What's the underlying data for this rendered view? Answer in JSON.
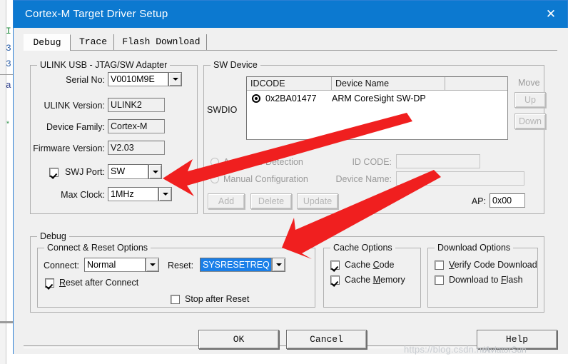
{
  "window": {
    "title": "Cortex-M Target Driver Setup",
    "close_icon": "close-icon"
  },
  "tabs": [
    {
      "label": "Debug",
      "active": true
    },
    {
      "label": "Trace",
      "active": false
    },
    {
      "label": "Flash Download",
      "active": false
    }
  ],
  "ulink_group": {
    "title": "ULINK USB - JTAG/SW Adapter",
    "serial_label": "Serial No:",
    "serial_value": "V0010M9E",
    "ulink_version_label": "ULINK Version:",
    "ulink_version_value": "ULINK2",
    "device_family_label": "Device Family:",
    "device_family_value": "Cortex-M",
    "firmware_version_label": "Firmware Version:",
    "firmware_version_value": "V2.03",
    "swj_label": "SWJ",
    "swj_checked": true,
    "port_label": "Port:",
    "port_value": "SW",
    "max_clock_label": "Max Clock:",
    "max_clock_value": "1MHz"
  },
  "sw_device_group": {
    "title": "SW Device",
    "swdio_label": "SWDIO",
    "columns": [
      "IDCODE",
      "Device Name",
      ""
    ],
    "rows": [
      {
        "selected": true,
        "idcode": "0x2BA01477",
        "device_name": "ARM CoreSight SW-DP"
      }
    ],
    "move_label": "Move",
    "up_label": "Up",
    "down_label": "Down",
    "automatic_detection_label": "Automatic Detection",
    "automatic_detection_selected": true,
    "manual_configuration_label": "Manual Configuration",
    "manual_configuration_selected": false,
    "id_code_label": "ID CODE:",
    "id_code_value": "",
    "device_name_label": "Device Name:",
    "device_name_value": "",
    "add_label": "Add",
    "delete_label": "Delete",
    "update_label": "Update",
    "ap_label": "AP:",
    "ap_value": "0x00"
  },
  "debug_group": {
    "title": "Debug",
    "connect_reset": {
      "title": "Connect & Reset Options",
      "connect_label": "Connect:",
      "connect_value": "Normal",
      "reset_label": "Reset:",
      "reset_value": "SYSRESETREQ",
      "reset_after_connect_label": "Reset after Connect",
      "reset_after_connect_checked": true,
      "stop_after_reset_label": "Stop after Reset",
      "stop_after_reset_checked": false
    },
    "cache_options": {
      "title": "Cache Options",
      "cache_code_label": "Cache Code",
      "cache_code_checked": true,
      "cache_memory_label": "Cache Memory",
      "cache_memory_checked": true
    },
    "download_options": {
      "title": "Download Options",
      "verify_code_download_label": "Verify Code Download",
      "verify_code_download_checked": false,
      "download_to_flash_label": "Download to Flash",
      "download_to_flash_checked": false
    }
  },
  "footer": {
    "ok_label": "OK",
    "cancel_label": "Cancel",
    "help_label": "Help"
  },
  "watermark": {
    "text": "https://blog.csdn.net",
    "text2": "/AviatorSun"
  },
  "background_editor": {
    "lines": [
      "I",
      "3",
      "3",
      "a",
      "*"
    ]
  },
  "colors": {
    "title_bar": "#0c79d0",
    "dialog_bg": "#f0f0f0",
    "arrow_red": "#f01f1f",
    "selection_blue": "#1a7fe8"
  }
}
